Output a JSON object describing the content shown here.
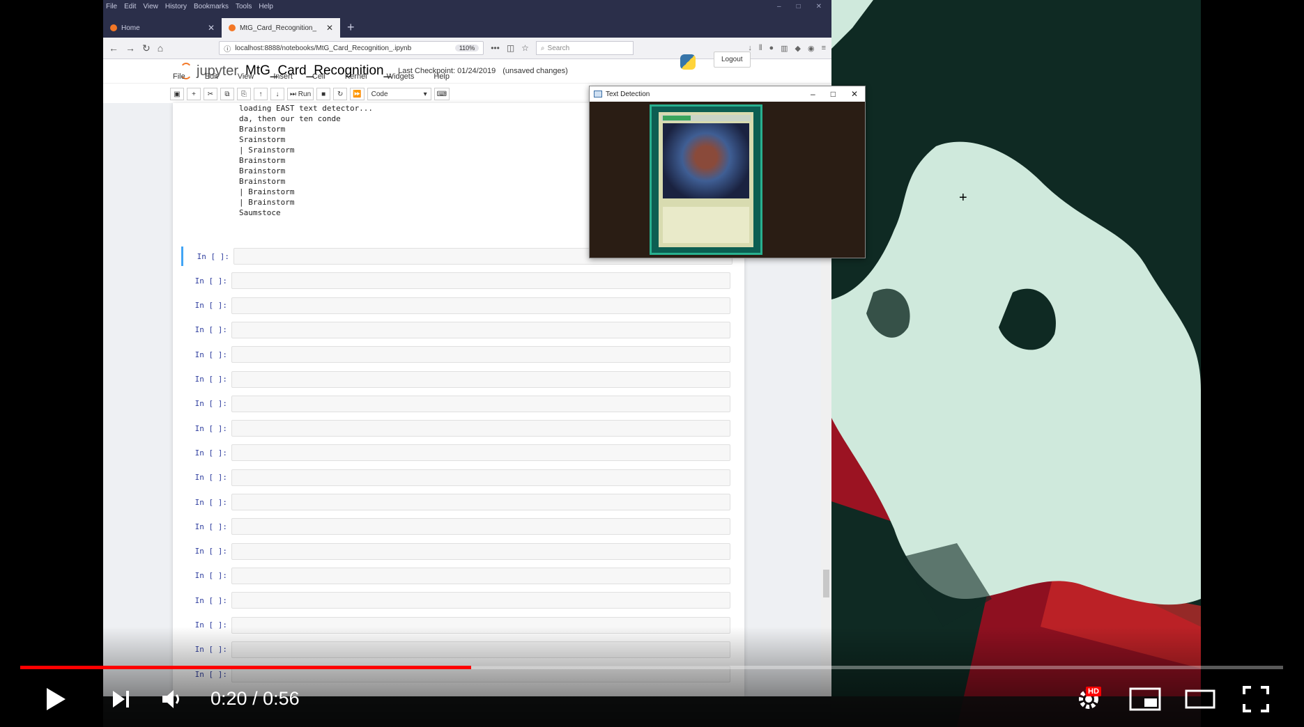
{
  "browser": {
    "menu_items": [
      "File",
      "Edit",
      "View",
      "History",
      "Bookmarks",
      "Tools",
      "Help"
    ],
    "tabs": [
      {
        "label": "Home"
      },
      {
        "label": "MtG_Card_Recognition_"
      }
    ],
    "url": "localhost:8888/notebooks/MtG_Card_Recognition_.ipynb",
    "zoom": "110%",
    "search_placeholder": "Search"
  },
  "jupyter": {
    "logo_text": "jupyter",
    "notebook_name": "MtG_Card_Recognition_",
    "checkpoint": "Last Checkpoint: 01/24/2019",
    "unsaved": "(unsaved changes)",
    "logout_label": "Logout",
    "menu": [
      "File",
      "Edit",
      "View",
      "Insert",
      "Cell",
      "Kernel",
      "Widgets",
      "Help"
    ],
    "toolbar": {
      "run_label": "Run",
      "cell_type": "Code"
    },
    "output_lines": [
      "loading EAST text detector...",
      "da, then our ten conde",
      "Brainstorm",
      "Srainstorm",
      "| Srainstorm",
      "Brainstorm",
      "Brainstorm",
      "Brainstorm",
      "| Brainstorm",
      "| Brainstorm",
      "Saumstoce"
    ],
    "empty_prompt": "In [ ]:"
  },
  "text_detection_window": {
    "title": "Text Detection"
  },
  "player": {
    "current_time": "0:20",
    "duration": "0:56",
    "progress_fraction": 0.357,
    "hd_badge": "HD",
    "accent_color": "#ff0000"
  }
}
